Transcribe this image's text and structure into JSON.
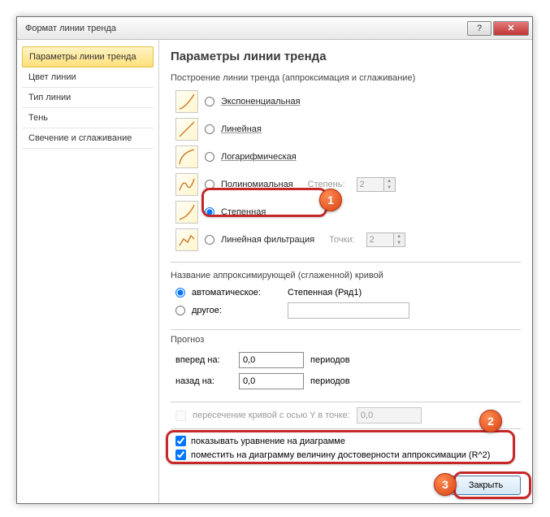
{
  "title": "Формат линии тренда",
  "sidebar": {
    "items": [
      {
        "label": "Параметры линии тренда",
        "active": true
      },
      {
        "label": "Цвет линии"
      },
      {
        "label": "Тип линии"
      },
      {
        "label": "Тень"
      },
      {
        "label": "Свечение и сглаживание"
      }
    ]
  },
  "main": {
    "heading": "Параметры линии тренда",
    "build_group": "Построение линии тренда (аппроксимация и сглаживание)",
    "types": {
      "exponential": "Экспоненциальная",
      "linear": "Линейная",
      "logarithmic": "Логарифмическая",
      "polynomial": "Полиномиальная",
      "power": "Степенная",
      "moving_avg": "Линейная фильтрация"
    },
    "degree_label": "Степень:",
    "degree_value": "2",
    "points_label": "Точки:",
    "points_value": "2",
    "name_group": "Название аппроксимирующей (сглаженной) кривой",
    "name_auto": "автоматическое:",
    "name_auto_value": "Степенная (Ряд1)",
    "name_other": "другое:",
    "forecast_group": "Прогноз",
    "forward_label": "вперед на:",
    "forward_value": "0,0",
    "backward_label": "назад на:",
    "backward_value": "0,0",
    "periods": "периодов",
    "intercept_label": "пересечение кривой с осью Y в точке:",
    "intercept_value": "0,0",
    "show_equation": "показывать уравнение на диаграмме",
    "show_r2": "поместить на диаграмму величину достоверности аппроксимации (R^2)"
  },
  "footer": {
    "close": "Закрыть"
  },
  "badges": {
    "one": "1",
    "two": "2",
    "three": "3"
  }
}
